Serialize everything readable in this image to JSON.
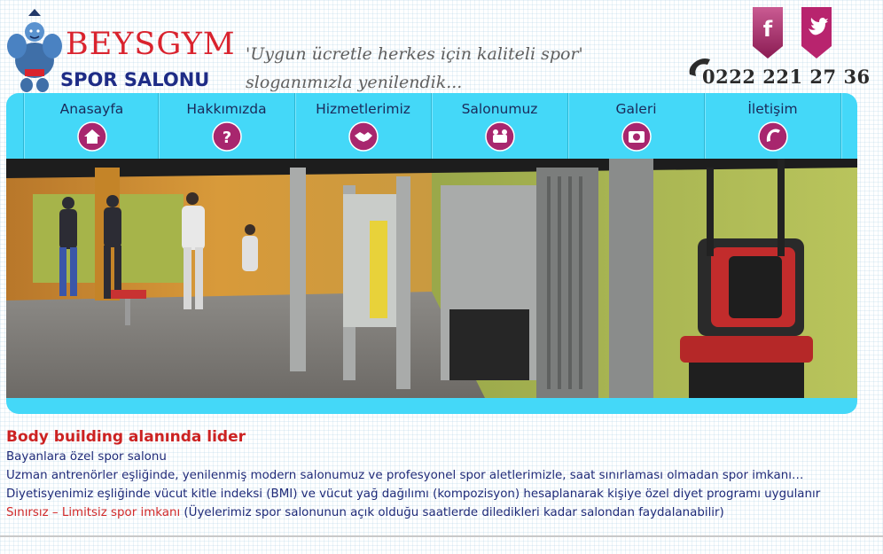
{
  "brand": {
    "name": "BEYSGYM",
    "subtitle": "SPOR SALONU",
    "slogan_line1": "'Uygun ücretle herkes için kaliteli spor'",
    "slogan_line2": "sloganımızla yenilendik..."
  },
  "contact": {
    "phone": "0222 221 27 36"
  },
  "social": [
    {
      "icon": "facebook-icon",
      "color": "#b8246e"
    },
    {
      "icon": "twitter-icon",
      "color": "#b8246e"
    }
  ],
  "nav": {
    "items": [
      {
        "label": "Anasayfa",
        "icon": "home-icon"
      },
      {
        "label": "Hakkımızda",
        "icon": "question-icon"
      },
      {
        "label": "Hizmetlerimiz",
        "icon": "handshake-icon"
      },
      {
        "label": "Salonumuz",
        "icon": "room-icon"
      },
      {
        "label": "Galeri",
        "icon": "camera-icon"
      },
      {
        "label": "İletişim",
        "icon": "phone-icon"
      }
    ]
  },
  "colors": {
    "nav_background": "#44d8f8",
    "icon_button": "#a8266e",
    "brand_red": "#d9232e",
    "brand_blue": "#1e2c86",
    "text_blue": "#1e2a78"
  },
  "content": {
    "title": "Body building alanında lider",
    "line1": "Bayanlara özel spor salonu",
    "line2": "Uzman antrenörler eşliğinde, yenilenmiş modern salonumuz ve profesyonel spor aletlerimizle, saat sınırlaması olmadan spor imkanı…",
    "line3": "Diyetisyenimiz eşliğinde vücut kitle indeksi (BMI) ve vücut yağ dağılımı (kompozisyon) hesaplanarak kişiye özel diyet programı uygulanır",
    "line4_highlight": "Sınırsız – Limitsiz spor imkanı",
    "line4_rest": " (Üyelerimiz spor salonunun açık olduğu saatlerde diledikleri kadar salondan faydalanabilir)"
  }
}
